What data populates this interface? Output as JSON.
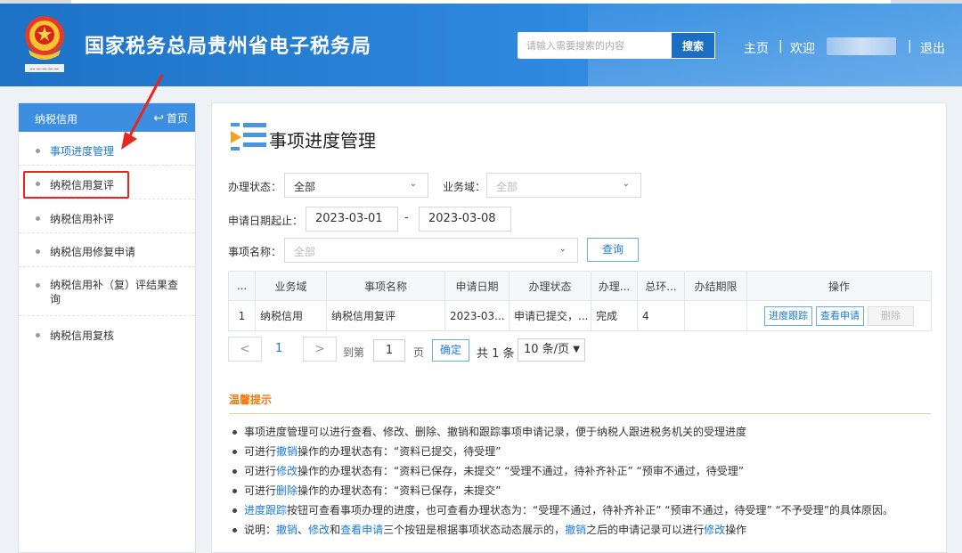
{
  "header": {
    "site_title": "国家税务总局贵州省电子税务局",
    "search_placeholder": "请输入需要搜索的内容",
    "search_button": "搜索",
    "nav_home": "主页",
    "nav_sep": "|",
    "nav_welcome": "欢迎",
    "nav_logout": "退出",
    "brand_color": "#2a84dc"
  },
  "sidebar": {
    "title": "纳税信用",
    "home_link": "首页",
    "items": [
      {
        "label": "事项进度管理",
        "active": true
      },
      {
        "label": "纳税信用复评",
        "highlighted": true
      },
      {
        "label": "纳税信用补评"
      },
      {
        "label": "纳税信用修复申请"
      },
      {
        "label": "纳税信用补（复）评结果查询"
      },
      {
        "label": "纳税信用复核"
      }
    ]
  },
  "main": {
    "title": "事项进度管理",
    "filters": {
      "status_label": "办理状态：",
      "status_value": "全部",
      "domain_label": "业务域：",
      "domain_value": "全部",
      "date_label": "申请日期起止：",
      "date_start": "2023-03-01",
      "date_sep": "-",
      "date_end": "2023-03-08",
      "item_label": "事项名称：",
      "item_value": "全部",
      "query_button": "查询"
    },
    "table": {
      "headers": [
        "...",
        "业务域",
        "事项名称",
        "申请日期",
        "办理状态",
        "办理...",
        "总环...",
        "办结期限",
        "操作"
      ],
      "rows": [
        {
          "cells": [
            "1",
            "纳税信用",
            "纳税信用复评",
            "2023-03...",
            "申请已提交，...",
            "完成",
            "4",
            ""
          ],
          "actions": [
            "进度跟踪",
            "查看申请",
            "删除"
          ]
        }
      ]
    },
    "pagination": {
      "prev": "<",
      "current_page": "1",
      "next": ">",
      "goto_label": "到第",
      "goto_value": "1",
      "page_unit": "页",
      "confirm": "确定",
      "total": "共 1 条",
      "page_size": "10 条/页"
    },
    "tips": {
      "title": "温馨提示",
      "items": [
        {
          "parts": [
            {
              "t": "事项进度管理可以进行查看、修改、删除、撤销和跟踪事项申请记录，便于纳税人跟进税务机关的受理进度"
            }
          ]
        },
        {
          "parts": [
            {
              "t": "可进行"
            },
            {
              "t": "撤销",
              "hl": true
            },
            {
              "t": "操作的办理状态有：“资料已提交，待受理”"
            }
          ]
        },
        {
          "parts": [
            {
              "t": "可进行"
            },
            {
              "t": "修改",
              "hl": true
            },
            {
              "t": "操作的办理状态有：“资料已保存，未提交”  “受理不通过，待补齐补正”  “预审不通过，待受理”"
            }
          ]
        },
        {
          "parts": [
            {
              "t": "可进行"
            },
            {
              "t": "删除",
              "hl": true
            },
            {
              "t": "操作的办理状态有：“资料已保存，未提交”"
            }
          ]
        },
        {
          "parts": [
            {
              "t": "进度跟踪",
              "hl": true
            },
            {
              "t": "按钮可查看事项办理的进度，也可查看办理状态为：“受理不通过，待补齐补正”  “预审不通过，待受理”  “不予受理”的具体原因。"
            }
          ]
        },
        {
          "parts": [
            {
              "t": "说明："
            },
            {
              "t": "撤销",
              "hl": true
            },
            {
              "t": "、"
            },
            {
              "t": "修改",
              "hl": true
            },
            {
              "t": "和"
            },
            {
              "t": "查看申请",
              "hl": true
            },
            {
              "t": "三个按钮是根据事项状态动态展示的，"
            },
            {
              "t": "撤销",
              "hl": true
            },
            {
              "t": "之后的申请记录可以进行"
            },
            {
              "t": "修改",
              "hl": true
            },
            {
              "t": "操作"
            }
          ]
        }
      ]
    }
  }
}
